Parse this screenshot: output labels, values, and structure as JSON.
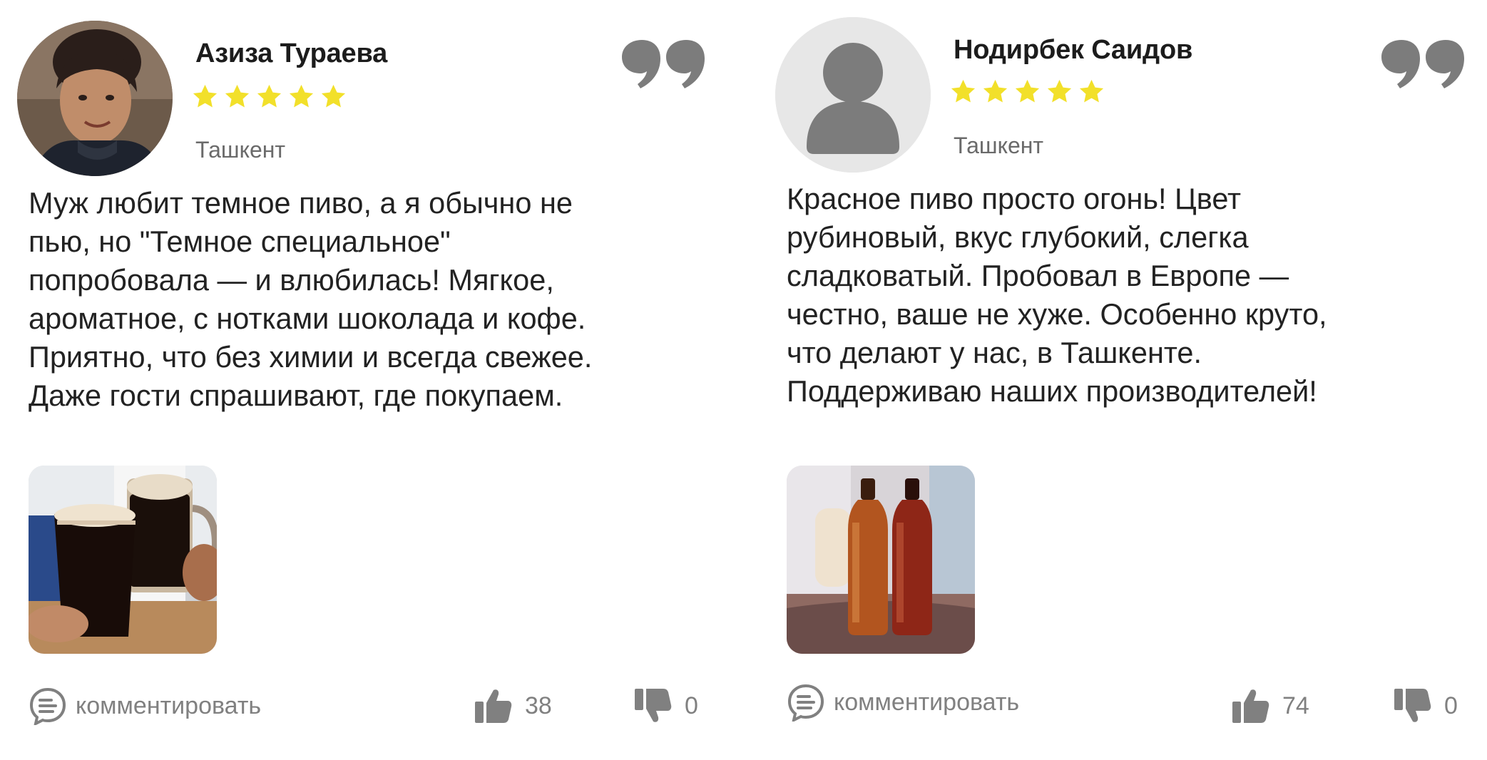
{
  "reviews": [
    {
      "name": "Азиза Тураева",
      "rating": 5,
      "city": "Ташкент",
      "text_lines": [
        "Муж любит темное пиво, а я обычно не",
        "пью, но \"Темное специальное\"",
        "попробовала — и влюбилась! Мягкое,",
        "ароматное, с нотками шоколада и кофе.",
        "Приятно, что без химии и всегда свежее.",
        "Даже гости спрашивают, где покупаем."
      ],
      "comment_label": "комментировать",
      "likes": "38",
      "dislikes": "0"
    },
    {
      "name": "Нодирбек Саидов",
      "rating": 5,
      "city": "Ташкент",
      "text_lines": [
        "Красное пиво просто огонь! Цвет",
        "рубиновый, вкус глубокий, слегка",
        "сладковатый. Пробовал в Европе —",
        "честно, ваше не хуже. Особенно круто,",
        "что делают у нас, в Ташкенте.",
        "Поддерживаю наших производителей!"
      ],
      "comment_label": "комментировать",
      "likes": "74",
      "dislikes": "0"
    }
  ],
  "colors": {
    "star": "#f2e02a",
    "icon_gray": "#808080",
    "quote_gray": "#7c7c7c"
  }
}
